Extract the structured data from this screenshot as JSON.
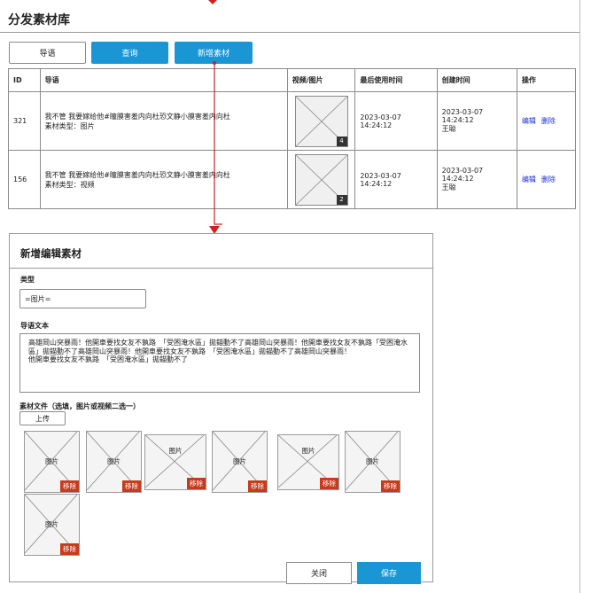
{
  "page": {
    "title": "分发素材库"
  },
  "toolbar": {
    "lead_button": "导语",
    "query_button": "查询",
    "add_button": "新增素材"
  },
  "table": {
    "headers": [
      "ID",
      "导语",
      "视频/图片",
      "最后使用时间",
      "创建时间",
      "操作"
    ],
    "rows": [
      {
        "id": "321",
        "text_line1": "我不管 我要嫁给他#瞳膜害羞内向杜恐文静小膜害羞内向杜",
        "text_line2": "素材类型：图片",
        "media_count": "4",
        "last_used": "2023-03-07 14:24:12",
        "created_time": "2023-03-07 14:24:12",
        "created_by": "王聪",
        "edit": "编辑",
        "delete": "删除"
      },
      {
        "id": "156",
        "text_line1": "我不管 我要嫁给他#瞳膜害羞内向杜恐文静小膜害羞内向杜",
        "text_line2": "素材类型：视频",
        "media_count": "2",
        "last_used": "2023-03-07 14:24:12",
        "created_time": "2023-03-07 14:24:12",
        "created_by": "王聪",
        "edit": "编辑",
        "delete": "删除"
      }
    ]
  },
  "modal": {
    "title": "新增编辑素材",
    "type_label": "类型",
    "type_value": "=图片=",
    "text_label": "导语文本",
    "text_value": "高雄岡山突暴雨！他開車要找女友不孰路　「受困淹水區」拋錨動不了高雄岡山突暴雨！他開車要找女友不孰路「受困淹水區」拋錨動不了高雄岡山突暴雨！他開車要找女友不孰路　「受困淹水區」拋錨動不了高雄岡山突暴雨！\n他開車要找女友不孰路　「受困淹水區」拋錨動不了",
    "file_label": "素材文件（选填，图片或视频二选一）",
    "upload_button": "上传",
    "media_label": "图片",
    "remove_label": "移除",
    "close_button": "关闭",
    "save_button": "保存"
  },
  "colors": {
    "accent": "#1a96d4",
    "danger": "#c83a1c",
    "link": "#1b2fd6",
    "connector": "#cc2222"
  }
}
